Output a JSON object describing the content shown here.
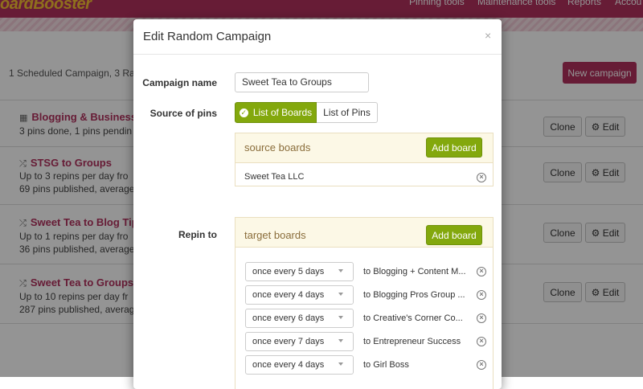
{
  "app": {
    "logo": "oardBooster",
    "nav": [
      "Pinning tools",
      "Maintenance tools",
      "Reports",
      "Accou"
    ]
  },
  "page": {
    "summary": "1 Scheduled Campaign, 3 Ra",
    "new_campaign_label": "New campaign",
    "clone_label": "Clone",
    "edit_label": "Edit",
    "campaigns": [
      {
        "title": "Blogging & Business",
        "line1": "3 pins done, 1 pins pendin",
        "line2": ""
      },
      {
        "title": "STSG to Groups",
        "line1": "Up to 3 repins per day fro",
        "line2": "69 pins published, average"
      },
      {
        "title": "Sweet Tea to Blog Tip",
        "line1": "Up to 1 repins per day fro",
        "line2": "36 pins published, average"
      },
      {
        "title": "Sweet Tea to Groups",
        "line1": "Up to 10 repins per day fr",
        "line2": "287 pins published, averag"
      }
    ]
  },
  "modal": {
    "title": "Edit Random Campaign",
    "close_glyph": "×",
    "campaign_name_label": "Campaign name",
    "campaign_name_value": "Sweet Tea to Groups",
    "source_label": "Source of pins",
    "source_options": [
      "List of Boards",
      "List of Pins"
    ],
    "source_selected": "List of Boards",
    "source_panel_title": "source boards",
    "add_board_label": "Add board",
    "source_boards": [
      "Sweet Tea LLC"
    ],
    "repin_label": "Repin to",
    "target_panel_title": "target boards",
    "targets": [
      {
        "frequency": "once every 5 days",
        "board": "to Blogging + Content M..."
      },
      {
        "frequency": "once every 4 days",
        "board": "to Blogging Pros Group ..."
      },
      {
        "frequency": "once every 6 days",
        "board": "to Creative's Corner Co..."
      },
      {
        "frequency": "once every 7 days",
        "board": "to Entrepreneur Success"
      },
      {
        "frequency": "once every 4 days",
        "board": "to Girl Boss"
      }
    ]
  },
  "colors": {
    "brand": "#b1315e",
    "accent_green": "#83a80d",
    "panel_bg": "#fcf8e6",
    "panel_title": "#8a6d3b"
  },
  "icons": {
    "calendar": "calendar-icon",
    "shuffle": "shuffle-icon",
    "gear": "gear-icon",
    "check": "check-circle-icon",
    "remove": "remove-circle-icon",
    "caret": "caret-down-icon"
  }
}
